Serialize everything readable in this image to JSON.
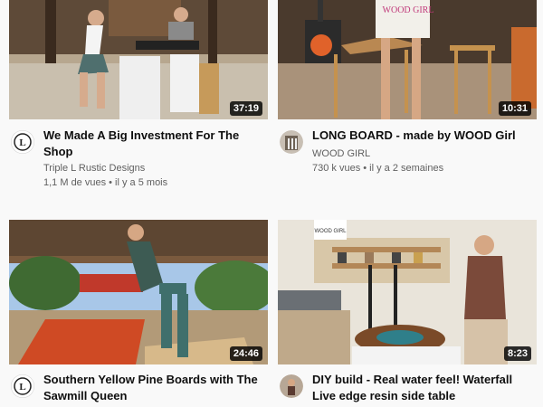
{
  "videos": [
    {
      "title_line1": "We Made A Big Investment For The",
      "title_line2": "Shop",
      "channel": "Triple L Rustic Designs",
      "meta": "1,1 M de vues • il y a 5 mois",
      "duration": "37:19",
      "avatar_letter": "L"
    },
    {
      "title_line1": "LONG BOARD - made by WOOD Girl",
      "title_line2": "",
      "channel": "WOOD GIRL",
      "meta": "730 k vues • il y a 2 semaines",
      "duration": "10:31",
      "watermark": "WOOD GIRL"
    },
    {
      "title_line1": "Southern Yellow Pine Boards with The",
      "title_line2": "Sawmill Queen",
      "channel": "",
      "meta": "",
      "duration": "24:46",
      "avatar_letter": "L"
    },
    {
      "title_line1": "DIY build - Real water feel! Waterfall",
      "title_line2": "Live edge resin side table",
      "channel": "",
      "meta": "",
      "duration": "8:23",
      "sign": "WOOD GIRL"
    }
  ]
}
